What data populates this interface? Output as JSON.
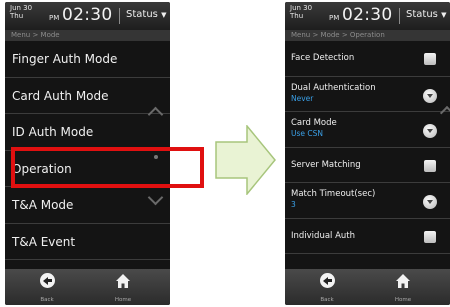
{
  "status_bar": {
    "date_line1": "Jun 30",
    "date_line2": "Thu",
    "ampm": "PM",
    "time": "02:30",
    "status_label": "Status"
  },
  "left_screen": {
    "breadcrumb": "Menu > Mode",
    "items": [
      {
        "label": "Finger Auth Mode"
      },
      {
        "label": "Card Auth Mode"
      },
      {
        "label": "ID Auth Mode"
      },
      {
        "label": "Operation",
        "highlighted": true
      },
      {
        "label": "T&A Mode"
      },
      {
        "label": "T&A Event"
      }
    ]
  },
  "right_screen": {
    "breadcrumb": "Menu > Mode > Operation",
    "items": [
      {
        "label": "Face Detection",
        "control": "checkbox"
      },
      {
        "label": "Dual Authentication",
        "value": "Never",
        "control": "dropdown"
      },
      {
        "label": "Card Mode",
        "value": "Use CSN",
        "control": "dropdown"
      },
      {
        "label": "Server Matching",
        "control": "checkbox"
      },
      {
        "label": "Match Timeout(sec)",
        "value": "3",
        "control": "dropdown"
      },
      {
        "label": "Individual Auth",
        "control": "checkbox"
      }
    ]
  },
  "bottom_bar": {
    "back_label": "Back",
    "home_label": "Home"
  },
  "colors": {
    "highlight": "#e01010",
    "value_text": "#3a9fe6",
    "arrow_fill": "#e9f3d4",
    "arrow_stroke": "#a7c57c"
  },
  "icons": {
    "back": "back-arrow-icon",
    "home": "home-icon",
    "status": "chevron-down-icon"
  }
}
